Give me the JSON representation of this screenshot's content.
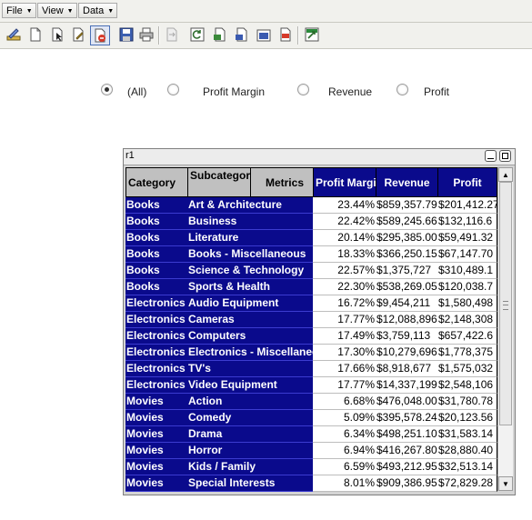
{
  "menus": [
    {
      "label": "File"
    },
    {
      "label": "View"
    },
    {
      "label": "Data"
    }
  ],
  "radio_options": [
    {
      "label": "(All)",
      "selected": true
    },
    {
      "label": "Profit Margin",
      "selected": false
    },
    {
      "label": "Revenue",
      "selected": false
    },
    {
      "label": "Profit",
      "selected": false
    }
  ],
  "grid": {
    "title": "r1",
    "headers": {
      "category": "Category",
      "subcategory": "Subcategory",
      "metrics": "Metrics",
      "profit_margin": "Profit Margin",
      "revenue": "Revenue",
      "profit": "Profit"
    },
    "rows": [
      {
        "category": "Books",
        "subcategory": "Art & Architecture",
        "margin": "23.44%",
        "revenue": "$859,357.79",
        "profit": "$201,412.27"
      },
      {
        "category": "Books",
        "subcategory": "Business",
        "margin": "22.42%",
        "revenue": "$589,245.66",
        "profit": "$132,116.6"
      },
      {
        "category": "Books",
        "subcategory": "Literature",
        "margin": "20.14%",
        "revenue": "$295,385.00",
        "profit": "$59,491.32"
      },
      {
        "category": "Books",
        "subcategory": "Books - Miscellaneous",
        "margin": "18.33%",
        "revenue": "$366,250.15",
        "profit": "$67,147.70"
      },
      {
        "category": "Books",
        "subcategory": "Science & Technology",
        "margin": "22.57%",
        "revenue": "$1,375,727",
        "profit": "$310,489.1"
      },
      {
        "category": "Books",
        "subcategory": "Sports & Health",
        "margin": "22.30%",
        "revenue": "$538,269.05",
        "profit": "$120,038.7"
      },
      {
        "category": "Electronics",
        "subcategory": "Audio Equipment",
        "margin": "16.72%",
        "revenue": "$9,454,211",
        "profit": "$1,580,498"
      },
      {
        "category": "Electronics",
        "subcategory": "Cameras",
        "margin": "17.77%",
        "revenue": "$12,088,896",
        "profit": "$2,148,308"
      },
      {
        "category": "Electronics",
        "subcategory": "Computers",
        "margin": "17.49%",
        "revenue": "$3,759,113",
        "profit": "$657,422.6"
      },
      {
        "category": "Electronics",
        "subcategory": "Electronics - Miscellaneous",
        "margin": "17.30%",
        "revenue": "$10,279,696",
        "profit": "$1,778,375"
      },
      {
        "category": "Electronics",
        "subcategory": "TV's",
        "margin": "17.66%",
        "revenue": "$8,918,677",
        "profit": "$1,575,032"
      },
      {
        "category": "Electronics",
        "subcategory": "Video Equipment",
        "margin": "17.77%",
        "revenue": "$14,337,199",
        "profit": "$2,548,106"
      },
      {
        "category": "Movies",
        "subcategory": "Action",
        "margin": "6.68%",
        "revenue": "$476,048.00",
        "profit": "$31,780.78"
      },
      {
        "category": "Movies",
        "subcategory": "Comedy",
        "margin": "5.09%",
        "revenue": "$395,578.24",
        "profit": "$20,123.56"
      },
      {
        "category": "Movies",
        "subcategory": "Drama",
        "margin": "6.34%",
        "revenue": "$498,251.10",
        "profit": "$31,583.14"
      },
      {
        "category": "Movies",
        "subcategory": "Horror",
        "margin": "6.94%",
        "revenue": "$416,267.80",
        "profit": "$28,880.40"
      },
      {
        "category": "Movies",
        "subcategory": "Kids / Family",
        "margin": "6.59%",
        "revenue": "$493,212.95",
        "profit": "$32,513.14"
      },
      {
        "category": "Movies",
        "subcategory": "Special Interests",
        "margin": "8.01%",
        "revenue": "$909,386.95",
        "profit": "$72,829.28"
      }
    ]
  },
  "colors": {
    "header_blue": "#0a0a8c",
    "header_gray": "#c0c0c0",
    "toolbar_bg": "#f1f1ed"
  }
}
